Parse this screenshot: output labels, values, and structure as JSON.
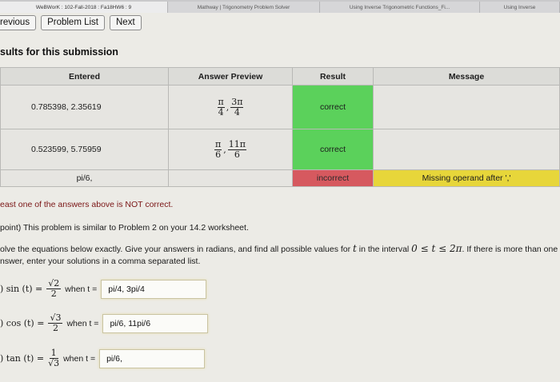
{
  "browser": {
    "tabs": [
      "WeBWorK : 102-Fall-2018 : Fa18HW6 : 9",
      "Mathway | Trigonometry Problem Solver",
      "Using Inverse Trigonometric Functions_Fi...",
      "Using Inverse"
    ]
  },
  "nav": {
    "previous_label": "revious",
    "problem_list_label": "Problem List",
    "next_label": "Next"
  },
  "page": {
    "results_title": "sults for this submission"
  },
  "results_table": {
    "headers": [
      "Entered",
      "Answer Preview",
      "Result",
      "Message"
    ],
    "rows": [
      {
        "entered": "0.785398, 2.35619",
        "preview": [
          {
            "num": "π",
            "den": "4"
          },
          {
            "num": "3π",
            "den": "4"
          }
        ],
        "result": "correct",
        "message": ""
      },
      {
        "entered": "0.523599, 5.75959",
        "preview": [
          {
            "num": "π",
            "den": "6"
          },
          {
            "num": "11π",
            "den": "6"
          }
        ],
        "result": "correct",
        "message": ""
      },
      {
        "entered": "pi/6,",
        "preview": [],
        "result": "incorrect",
        "message": "Missing operand after ','"
      }
    ]
  },
  "status": {
    "warning": "east one of the answers above is NOT correct."
  },
  "problem": {
    "intro": "point) This problem is similar to Problem 2 on your 14.2 worksheet.",
    "instructions_a": "olve the equations below exactly. Give your answers in radians, and find all possible values for ",
    "var_t": "t",
    "instructions_b": " in the interval ",
    "interval": "0 ≤ t ≤ 2π",
    "instructions_c": ". If there is more than one",
    "instructions_d": "nswer, enter your solutions in a comma separated list.",
    "equations": [
      {
        "lhs": ") sin (t) =",
        "num": "√2",
        "den": "2",
        "when": "when t =",
        "answer": "pi/4, 3pi/4"
      },
      {
        "lhs": ") cos (t) =",
        "num": "√3",
        "den": "2",
        "when": "when t =",
        "answer": "pi/6, 11pi/6"
      },
      {
        "lhs": ") tan (t) =",
        "num": "1",
        "den": "√3",
        "when": "when t =",
        "answer": "pi/6,"
      }
    ]
  },
  "colors": {
    "correct": "#5bd15b",
    "incorrect": "#d6595f",
    "message_warning": "#e7d63a"
  }
}
